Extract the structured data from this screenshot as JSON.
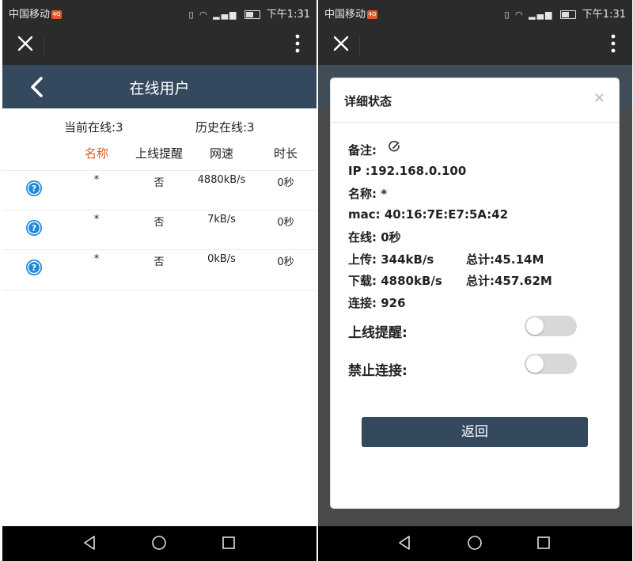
{
  "status_bar": {
    "carrier": "中国移动",
    "time": "下午1:31"
  },
  "list_page": {
    "title": "在线用户",
    "summary": {
      "current": "当前在线:3",
      "history": "历史在线:3"
    },
    "columns": [
      "名称",
      "上线提醒",
      "网速",
      "时长"
    ],
    "rows": [
      {
        "name": "*",
        "notify": "否",
        "speed": "4880kB/s",
        "duration": "0秒"
      },
      {
        "name": "*",
        "notify": "否",
        "speed": "7kB/s",
        "duration": "0秒"
      },
      {
        "name": "*",
        "notify": "否",
        "speed": "0kB/s",
        "duration": "0秒"
      }
    ]
  },
  "detail_modal": {
    "title": "详细状态",
    "close_label": "×",
    "remark_label": "备注:",
    "ip": "IP  :192.168.0.100",
    "name": "名称: *",
    "mac": "mac:  40:16:7E:E7:5A:42",
    "online": "在线:  0秒",
    "upload": "上传:  344kB/s",
    "upload_total": "总计:45.14M",
    "download": "下载:  4880kB/s",
    "download_total": "总计:457.62M",
    "connections": "连接: 926",
    "notify_label": "上线提醒:",
    "notify_on": false,
    "block_label": "禁止连接:",
    "block_on": false,
    "back_button": "返回"
  },
  "colors": {
    "header_bg": "#34495e",
    "active_column": "#e35a1c",
    "help_icon": "#1e88d8"
  }
}
